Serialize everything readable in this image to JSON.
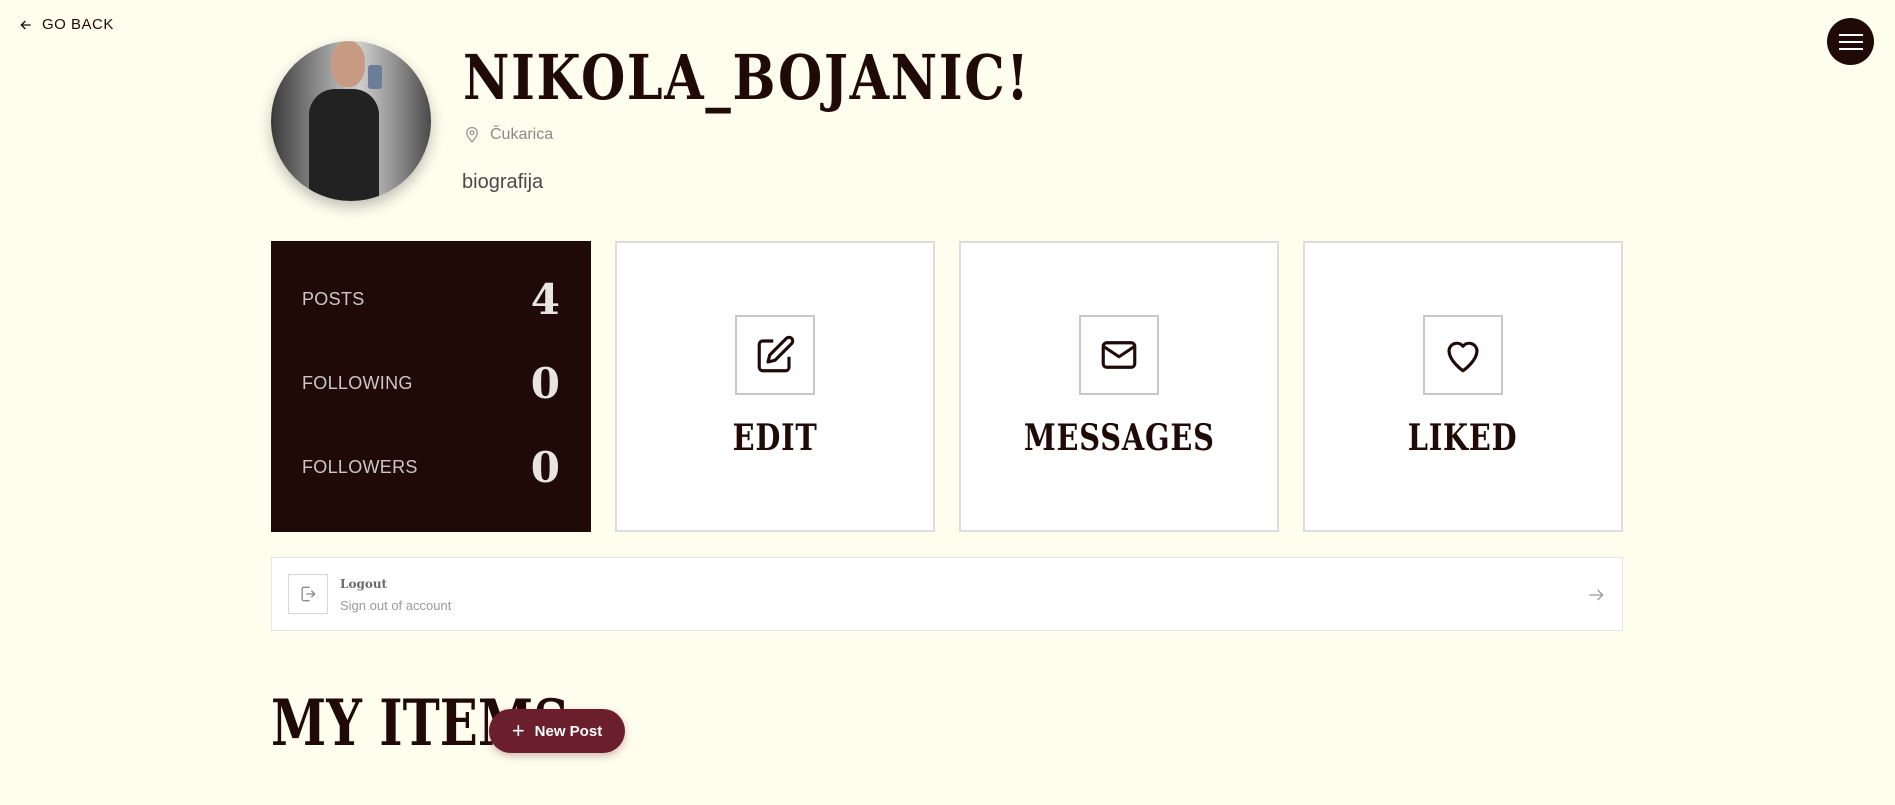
{
  "nav": {
    "go_back_label": "GO BACK"
  },
  "profile": {
    "username": "NIKOLA_BOJANIC!",
    "location": "Čukarica",
    "bio": "biografija"
  },
  "stats": [
    {
      "label": "POSTS",
      "value": "4"
    },
    {
      "label": "FOLLOWING",
      "value": "0"
    },
    {
      "label": "FOLLOWERS",
      "value": "0"
    }
  ],
  "cards": {
    "edit": "EDIT",
    "messages": "MESSAGES",
    "liked": "LIKED"
  },
  "logout": {
    "title": "Logout",
    "subtitle": "Sign out of account"
  },
  "items": {
    "heading": "MY ITEMS",
    "new_post_label": "New Post"
  },
  "colors": {
    "background": "#fefdee",
    "dark": "#1f0a08",
    "accent": "#6b1e2c"
  },
  "icons": {
    "back": "arrow-left-icon",
    "menu": "hamburger-menu-icon",
    "location": "map-pin-icon",
    "edit": "pencil-square-icon",
    "messages": "envelope-icon",
    "liked": "heart-icon",
    "logout": "logout-door-icon",
    "arrow": "arrow-right-icon",
    "plus": "plus-icon"
  }
}
